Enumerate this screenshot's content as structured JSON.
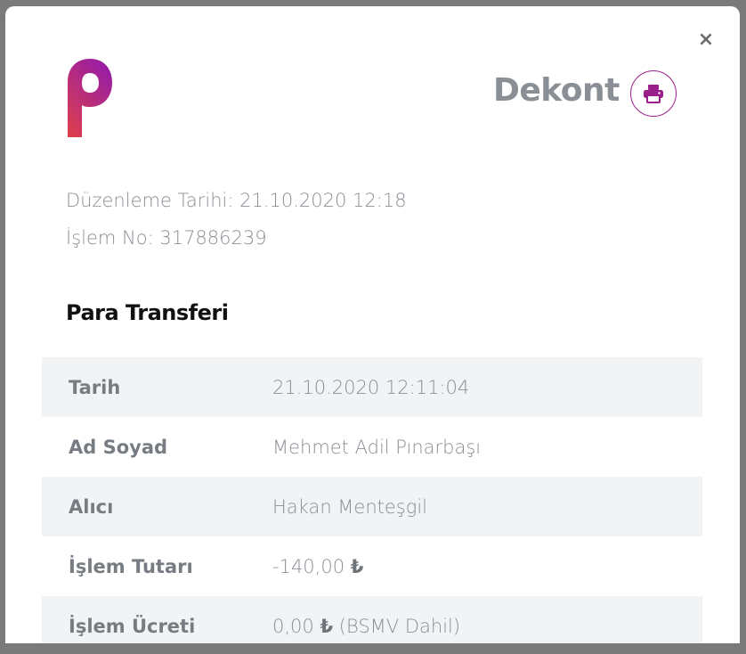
{
  "header": {
    "title": "Dekont",
    "close_glyph": "×",
    "brand_gradient": [
      "#e0404a",
      "#9b1fa0"
    ],
    "accent_color": "#9a1f8a"
  },
  "meta": {
    "issue_date_label": "Düzenleme Tarihi:",
    "issue_date_value": "21.10.2020 12:18",
    "transaction_no_label": "İşlem No:",
    "transaction_no_value": "317886239"
  },
  "section": {
    "title": "Para Transferi"
  },
  "details": {
    "rows": [
      {
        "label": "Tarih",
        "value": "21.10.2020 12:11:04"
      },
      {
        "label": "Ad Soyad",
        "value": "Mehmet Adil Pınarbaşı"
      },
      {
        "label": "Alıcı",
        "value": "Hakan Menteşgil"
      },
      {
        "label": "İşlem Tutarı",
        "value": "-140,00",
        "currency": "₺"
      },
      {
        "label": "İşlem Ücreti",
        "value": "0,00",
        "currency": "₺",
        "suffix": "(BSMV Dahil)"
      }
    ]
  }
}
